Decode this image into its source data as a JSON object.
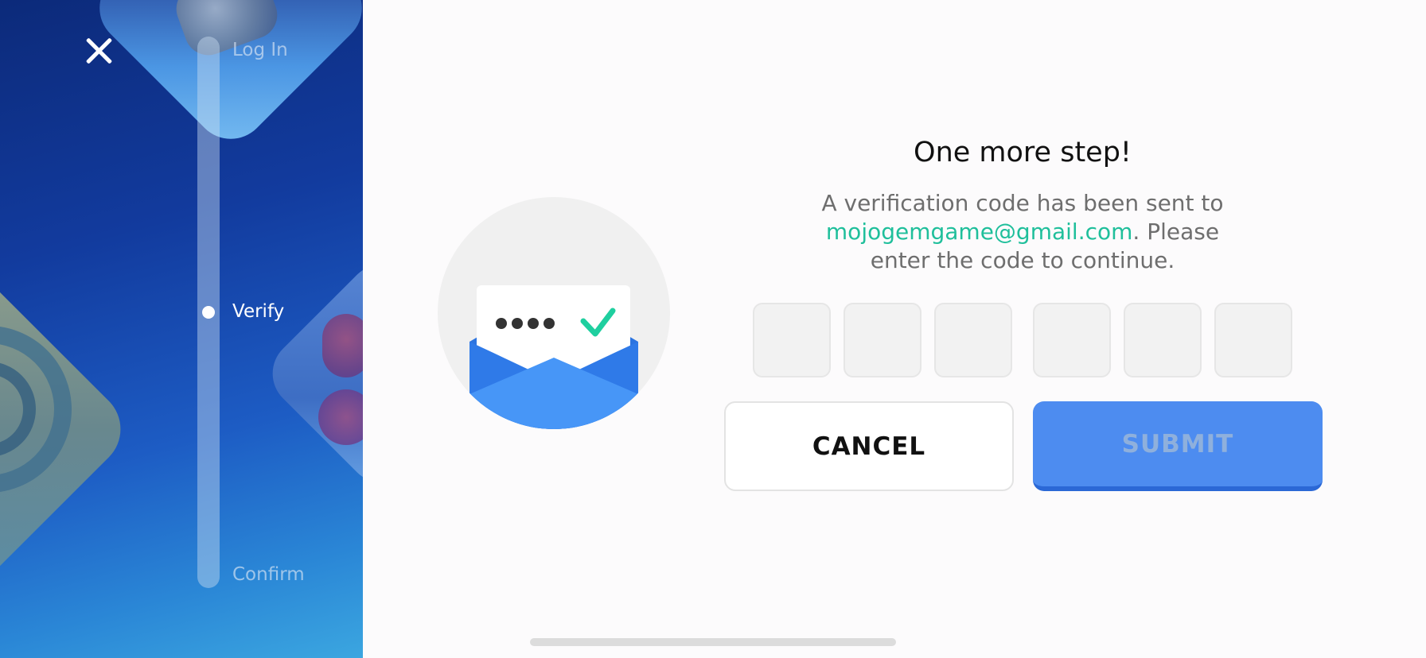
{
  "sidebar": {
    "steps": [
      {
        "label": "Log In"
      },
      {
        "label": "Verify"
      },
      {
        "label": "Confirm"
      }
    ],
    "active_step": "Verify"
  },
  "dialog": {
    "title": "One more step!",
    "desc_prefix": "A verification code has been sent to",
    "email": "mojogemgame@gmail.com",
    "desc_suffix": ". Please enter the code to continue.",
    "code_length": 6,
    "cancel_label": "CANCEL",
    "submit_label": "SUBMIT"
  },
  "colors": {
    "accent_green": "#1fbf9b",
    "submit_blue": "#4d8cf0",
    "envelope_blue": "#3f8ef5"
  },
  "icons": {
    "close": "close-icon",
    "envelope": "envelope-check-icon"
  }
}
